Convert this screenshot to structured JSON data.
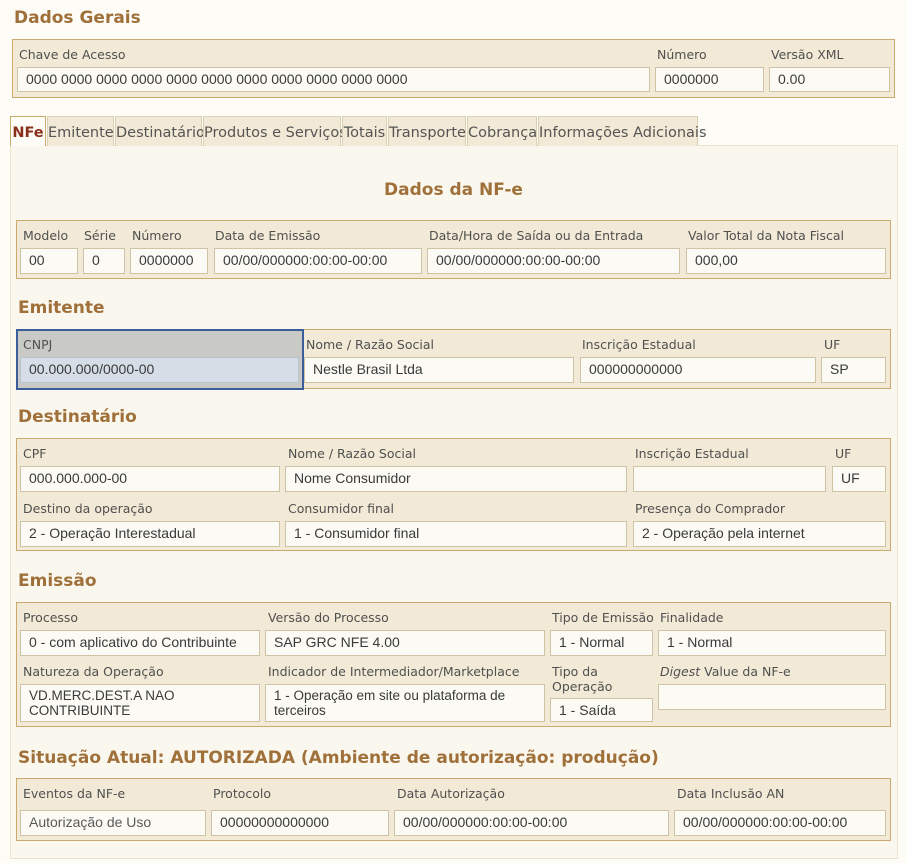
{
  "dados_gerais": {
    "title": "Dados Gerais",
    "chave_label": "Chave de Acesso",
    "chave_value": "0000 0000 0000 0000 0000 0000 0000 0000 0000 0000 0000",
    "numero_label": "Número",
    "numero_value": "0000000",
    "versao_label": "Versão XML",
    "versao_value": "0.00"
  },
  "tabs": [
    "NFe",
    "Emitente",
    "Destinatário",
    "Produtos e Serviços",
    "Totais",
    "Transporte",
    "Cobrança",
    "Informações Adicionais"
  ],
  "nfe": {
    "title": "Dados da NF-e",
    "modelo_label": "Modelo",
    "modelo_value": "00",
    "serie_label": "Série",
    "serie_value": "0",
    "numero_label": "Número",
    "numero_value": "0000000",
    "emissao_label": "Data de Emissão",
    "emissao_value": "00/00/000000:00:00-00:00",
    "saida_label": "Data/Hora de Saída ou da Entrada",
    "saida_value": "00/00/000000:00:00-00:00",
    "valor_label": "Valor Total da Nota Fiscal",
    "valor_value": "000,00"
  },
  "emitente": {
    "title": "Emitente",
    "cnpj_label": "CNPJ",
    "cnpj_value": "00.000.000/0000-00",
    "nome_label": "Nome / Razão Social",
    "nome_value": "Nestle Brasil Ltda",
    "ie_label": "Inscrição Estadual",
    "ie_value": "000000000000",
    "uf_label": "UF",
    "uf_value": "SP"
  },
  "destinatario": {
    "title": "Destinatário",
    "cpf_label": "CPF",
    "cpf_value": "000.000.000-00",
    "nome_label": "Nome / Razão Social",
    "nome_value": "Nome Consumidor",
    "ie_label": "Inscrição Estadual",
    "ie_value": "",
    "uf_label": "UF",
    "uf_value": "UF",
    "destino_label": "Destino da operação",
    "destino_value": "2 - Operação Interestadual",
    "consumidor_label": "Consumidor final",
    "consumidor_value": "1 - Consumidor final",
    "presenca_label": "Presença do Comprador",
    "presenca_value": "2 - Operação pela internet"
  },
  "emissao": {
    "title": "Emissão",
    "processo_label": "Processo",
    "processo_value": "0 - com aplicativo do Contribuinte",
    "versao_label": "Versão do Processo",
    "versao_value": "SAP GRC NFE 4.00",
    "tipo_emissao_label": "Tipo de Emissão",
    "tipo_emissao_value": "1 - Normal",
    "finalidade_label": "Finalidade",
    "finalidade_value": "1 - Normal",
    "natureza_label": "Natureza da Operação",
    "natureza_value": "VD.MERC.DEST.A NAO CONTRIBUINTE",
    "indicador_label": "Indicador de Intermediador/Marketplace",
    "indicador_value": "1 - Operação em site ou plataforma de terceiros",
    "tipo_operacao_label": "Tipo da Operação",
    "tipo_operacao_value": "1 - Saída",
    "digest_label_italic": "Digest",
    "digest_label_rest": " Value da NF-e",
    "digest_value": ""
  },
  "situacao": {
    "title": "Situação Atual: AUTORIZADA (Ambiente de autorização: produção)",
    "eventos_label": "Eventos da NF-e",
    "eventos_value": "Autorização de Uso",
    "protocolo_label": "Protocolo",
    "protocolo_value": "00000000000000",
    "autorizacao_label": "Data Autorização",
    "autorizacao_value": "00/00/000000:00:00-00:00",
    "inclusao_label": "Data Inclusão AN",
    "inclusao_value": "00/00/000000:00:00-00:00"
  },
  "colors": {
    "title": "#a0703a",
    "fieldset_bg": "#f2ead6",
    "fieldset_border": "#c9ab6f",
    "active_tab": "#8a2f1a",
    "highlight_border": "#3b5e9a"
  }
}
